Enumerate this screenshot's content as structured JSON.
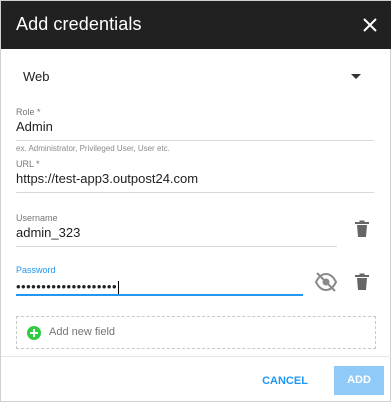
{
  "dialog": {
    "title": "Add credentials"
  },
  "type_select": {
    "value": "Web"
  },
  "role": {
    "label": "Role *",
    "value": "Admin",
    "hint": "ex. Administrator, Privileged User, User etc."
  },
  "url": {
    "label": "URL *",
    "value": "https://test-app3.outpost24.com"
  },
  "username": {
    "label": "Username",
    "value": "admin_323"
  },
  "password": {
    "label": "Password",
    "value": "••••••••••••••••••••"
  },
  "add_field": {
    "label": "Add new field"
  },
  "actions": {
    "cancel": "CANCEL",
    "add": "ADD"
  },
  "colors": {
    "header_bg": "#212121",
    "accent": "#2196f3",
    "add_button_bg": "#90caf9",
    "add_field_icon": "#2ecc40"
  },
  "icons": {
    "close": "close-icon",
    "dropdown": "chevron-down-icon",
    "trash": "trash-icon",
    "visibility_off": "eye-off-icon",
    "plus": "plus-circle-icon"
  }
}
